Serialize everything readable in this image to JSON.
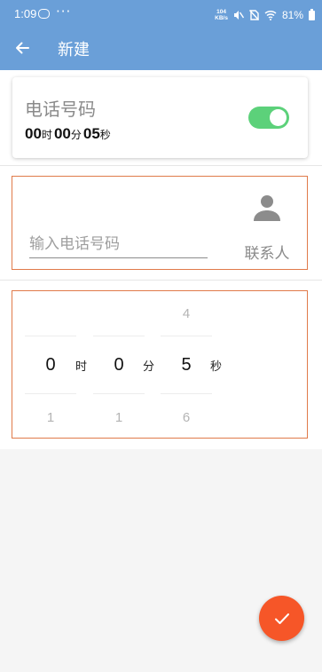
{
  "status_bar": {
    "time": "1:09",
    "more": "···",
    "net_speed_value": "104",
    "net_speed_unit": "KB/s",
    "battery": "81%"
  },
  "app_bar": {
    "title": "新建"
  },
  "summary": {
    "title": "电话号码",
    "hours": "00",
    "hours_unit": "时",
    "minutes": "00",
    "minutes_unit": "分",
    "seconds": "05",
    "seconds_unit": "秒",
    "enabled": true
  },
  "phone": {
    "placeholder": "输入电话号码",
    "value": "",
    "contact_label": "联系人"
  },
  "picker": {
    "hours": {
      "above": "",
      "selected": "0",
      "below": "1",
      "unit": "时"
    },
    "minutes": {
      "above": "",
      "selected": "0",
      "below": "1",
      "unit": "分"
    },
    "seconds": {
      "above": "4",
      "selected": "5",
      "below": "6",
      "unit": "秒"
    }
  },
  "colors": {
    "app_bar": "#6a9fd8",
    "toggle_on": "#5cd17a",
    "fab": "#f65628",
    "box_border": "#e07a4a"
  },
  "icons": {
    "back": "arrow-left-icon",
    "contact": "person-icon",
    "confirm": "check-icon"
  }
}
